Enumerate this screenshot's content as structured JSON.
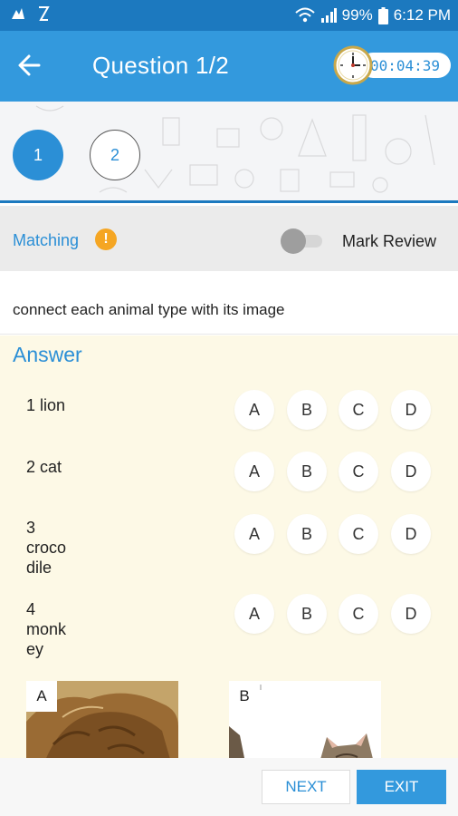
{
  "status_bar": {
    "battery": "99%",
    "time": "6:12 PM",
    "icons": [
      "notification-icon",
      "sync-icon",
      "wifi-icon",
      "signal-icon",
      "battery-icon"
    ]
  },
  "header": {
    "title": "Question 1/2",
    "timer": "00:04:39",
    "back_icon": "arrow-left-icon",
    "clock_icon": "clock-icon"
  },
  "questions": [
    "1",
    "2"
  ],
  "question_type": {
    "label": "Matching",
    "info_icon": "!",
    "review_label": "Mark Review",
    "review_on": false
  },
  "prompt": "connect each animal type with its image",
  "answer": {
    "title": "Answer",
    "options": [
      "A",
      "B",
      "C",
      "D"
    ],
    "items": [
      {
        "label": "1 lion"
      },
      {
        "label": "2 cat"
      },
      {
        "label": "3\ncroco\ndile"
      },
      {
        "label": "4\nmonk\ney"
      }
    ],
    "images": [
      {
        "tag": "A",
        "depicts": "lion"
      },
      {
        "tag": "B",
        "depicts": "cat"
      }
    ]
  },
  "footer": {
    "next_label": "NEXT",
    "exit_label": "EXIT"
  },
  "colors": {
    "status_bar": "#1c79bf",
    "header": "#3399dd",
    "accent": "#2b8fd6",
    "answer_bg": "#fdf9e6",
    "warning": "#f5a623"
  }
}
